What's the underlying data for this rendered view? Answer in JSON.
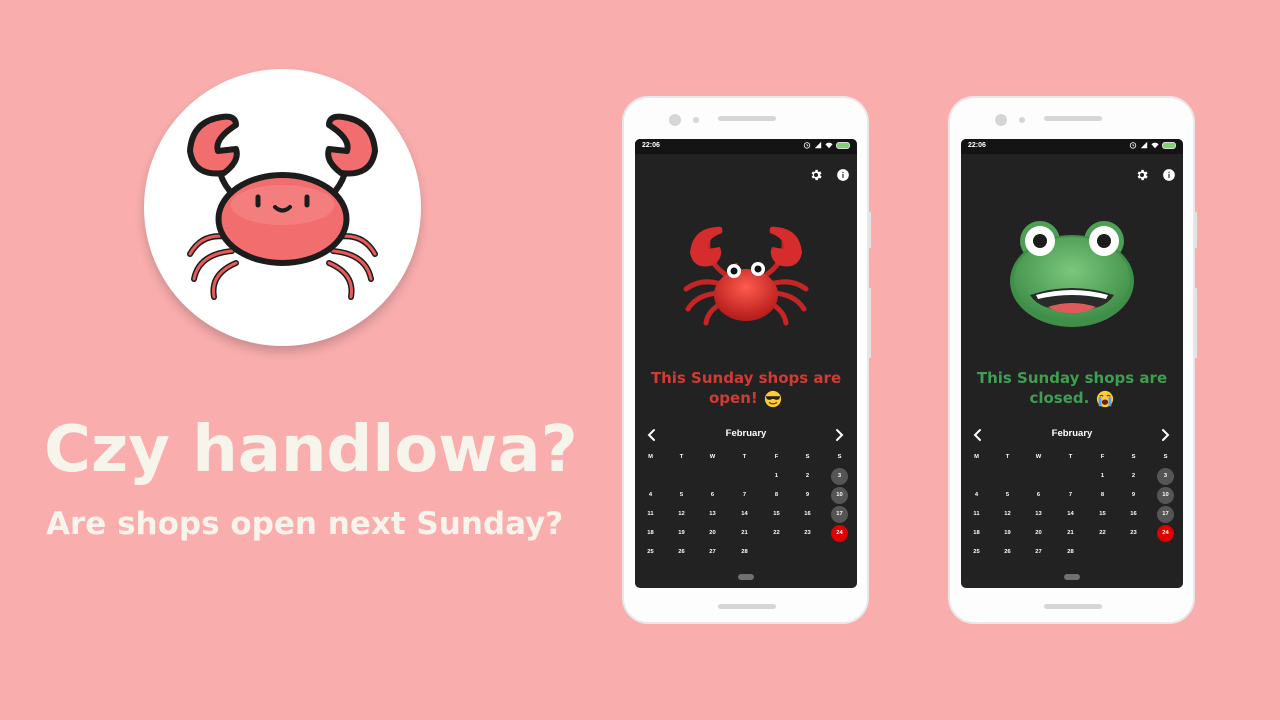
{
  "hero": {
    "logo_icon": "crab-icon",
    "title": "Czy handlowa?",
    "subtitle": "Are shops open next Sunday?"
  },
  "phones": [
    {
      "time": "22:06",
      "settings_icon": "gear-icon",
      "info_icon": "info-icon",
      "status_icon": "crab-icon",
      "status_text": "This Sunday shops are open!",
      "status_emoji": "smiling-face-with-sunglasses",
      "status_color": "#d23a34",
      "calendar": {
        "month": "February",
        "prev_icon": "chevron-left-icon",
        "next_icon": "chevron-right-icon",
        "weekdays": [
          "M",
          "T",
          "W",
          "T",
          "F",
          "S",
          "S"
        ],
        "weeks": [
          [
            "",
            "",
            "",
            "",
            "1",
            "2",
            "3"
          ],
          [
            "4",
            "5",
            "6",
            "7",
            "8",
            "9",
            "10"
          ],
          [
            "11",
            "12",
            "13",
            "14",
            "15",
            "16",
            "17"
          ],
          [
            "18",
            "19",
            "20",
            "21",
            "22",
            "23",
            "24"
          ],
          [
            "25",
            "26",
            "27",
            "28",
            "",
            "",
            ""
          ]
        ],
        "highlighted_sundays": [
          "3",
          "10",
          "17"
        ],
        "selected_day": "24"
      }
    },
    {
      "time": "22:06",
      "settings_icon": "gear-icon",
      "info_icon": "info-icon",
      "status_icon": "frog-icon",
      "status_text": "This Sunday shops are closed.",
      "status_emoji": "loudly-crying-face",
      "status_color": "#3f9e52",
      "calendar": {
        "month": "February",
        "prev_icon": "chevron-left-icon",
        "next_icon": "chevron-right-icon",
        "weekdays": [
          "M",
          "T",
          "W",
          "T",
          "F",
          "S",
          "S"
        ],
        "weeks": [
          [
            "",
            "",
            "",
            "",
            "1",
            "2",
            "3"
          ],
          [
            "4",
            "5",
            "6",
            "7",
            "8",
            "9",
            "10"
          ],
          [
            "11",
            "12",
            "13",
            "14",
            "15",
            "16",
            "17"
          ],
          [
            "18",
            "19",
            "20",
            "21",
            "22",
            "23",
            "24"
          ],
          [
            "25",
            "26",
            "27",
            "28",
            "",
            "",
            ""
          ]
        ],
        "highlighted_sundays": [
          "3",
          "10",
          "17"
        ],
        "selected_day": "24"
      }
    }
  ],
  "colors": {
    "background": "#f9adad",
    "hero_text": "#f7f4ec",
    "screen_bg": "#222222",
    "today_red": "#e00000",
    "sunday_grey": "#555555"
  }
}
